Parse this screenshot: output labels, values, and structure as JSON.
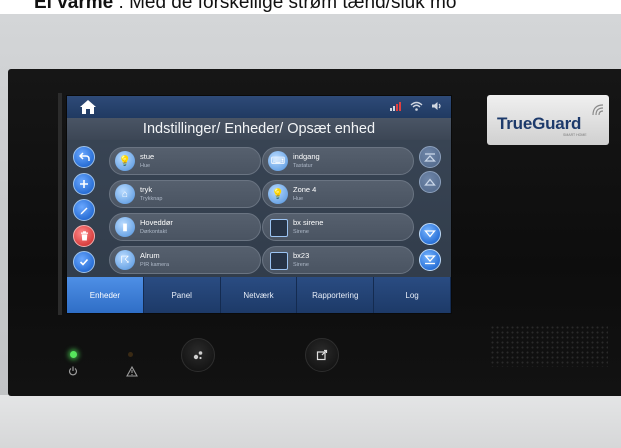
{
  "caption": {
    "bold": "El varme",
    "text": " : Med de forskellige strøm tænd/sluk mo"
  },
  "header": {
    "title": "Indstillinger/ Enheder/ Opsæt enhed"
  },
  "devices": [
    {
      "name": "stue",
      "type": "Hue",
      "icon": "bulb-icon"
    },
    {
      "name": "indgang",
      "type": "Tastatur",
      "icon": "keypad-icon"
    },
    {
      "name": "tryk",
      "type": "Trykknap",
      "icon": "house-icon"
    },
    {
      "name": "Zone 4",
      "type": "Hue",
      "icon": "bulb-icon"
    },
    {
      "name": "Hoveddør",
      "type": "Dørkontakt",
      "icon": "door-contact-icon"
    },
    {
      "name": "bx sirene",
      "type": "Sirene",
      "icon": "siren-icon"
    },
    {
      "name": "Alrum",
      "type": "PIR kamera",
      "icon": "pir-camera-icon"
    },
    {
      "name": "bx23",
      "type": "Sirene",
      "icon": "siren-icon"
    }
  ],
  "tabs": [
    "Enheder",
    "Panel",
    "Netværk",
    "Rapportering",
    "Log"
  ],
  "brand": {
    "name": "TrueGuard",
    "sub": "SMART HOME"
  },
  "colors": {
    "accent": "#2f6ec6",
    "delete": "#d94040",
    "topbar": "#203a62",
    "brand_text": "#1d3a6b"
  }
}
